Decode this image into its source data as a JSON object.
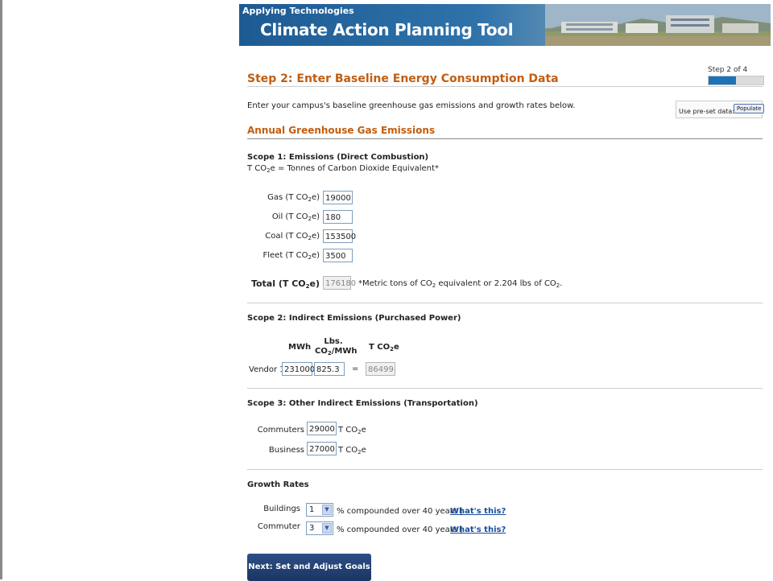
{
  "banner": {
    "overline": "Applying Technologies",
    "title": "Climate Action Planning Tool"
  },
  "step": {
    "heading": "Step 2: Enter Baseline Energy Consumption Data",
    "progress_label": "Step 2 of 4",
    "current": 2,
    "total": 4
  },
  "intro": "Enter your campus's baseline greenhouse gas emissions and growth rates below.",
  "preset": {
    "label": "Use pre-set data:",
    "button": "Populate"
  },
  "section_title": "Annual Greenhouse Gas Emissions",
  "scope1": {
    "title": "Scope 1: Emissions (Direct Combustion)",
    "subtitle_pre": "T CO",
    "subtitle_sub": "2",
    "subtitle_post": "e = Tonnes of Carbon Dioxide Equivalent*",
    "rows": [
      {
        "label": "Gas (T CO",
        "value": "19000"
      },
      {
        "label": "Oil (T CO",
        "value": "180"
      },
      {
        "label": "Coal (T CO",
        "value": "153500"
      },
      {
        "label": "Fleet (T CO",
        "value": "3500"
      }
    ],
    "unit_suffix": "e)",
    "sub2": "2",
    "total_label": "Total (T CO",
    "total_value": "176180",
    "note_pre": "*Metric tons of CO",
    "note_mid": " equivalent or 2.204 lbs of CO",
    "note_end": "."
  },
  "scope2": {
    "title": "Scope 2: Indirect Emissions (Purchased Power)",
    "col_mwh": "MWh",
    "col_lbs_top": "Lbs.",
    "col_lbs_pre": "CO",
    "col_lbs_post": "/MWh",
    "col_tco2_pre": "T CO",
    "col_tco2_post": "e",
    "vendor_label": "Vendor 1",
    "mwh": "231000",
    "lbs": "825.3",
    "equals": "=",
    "result": "86499"
  },
  "scope3": {
    "title": "Scope 3: Other Indirect Emissions (Transportation)",
    "commuters_label": "Commuters",
    "commuters_value": "29000",
    "business_label": "Business",
    "business_value": "27000",
    "unit_pre": "T CO",
    "unit_post": "e"
  },
  "growth": {
    "title": "Growth Rates",
    "rows": [
      {
        "label": "Buildings",
        "value": "1"
      },
      {
        "label": "Commuter",
        "value": "3"
      }
    ],
    "suffix": "% compounded over 40 years |",
    "link": "What's this?"
  },
  "next_button": "Next: Set and Adjust Goals",
  "colors": {
    "accent": "#c25d10",
    "banner": "#1d5a92",
    "button": "#1b3564",
    "link": "#1a4e9c"
  }
}
